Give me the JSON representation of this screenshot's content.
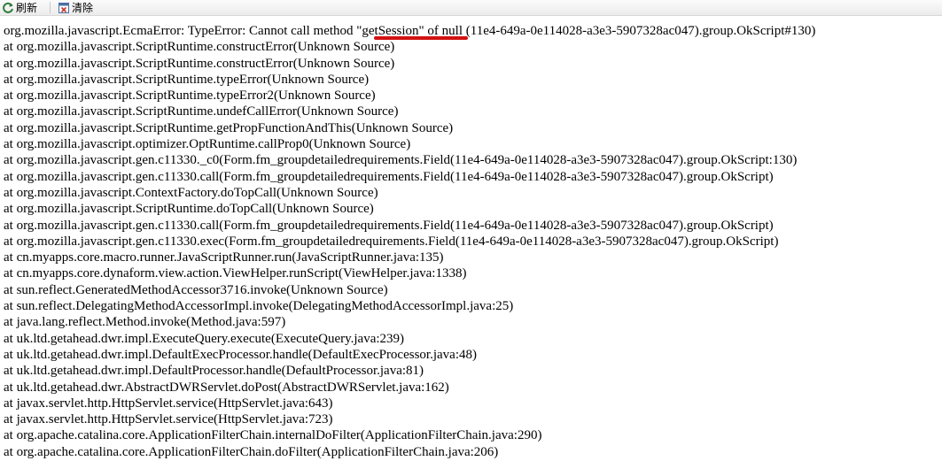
{
  "toolbar": {
    "refresh_label": "刷新",
    "clear_label": "清除",
    "refresh_icon": "refresh-icon",
    "clear_icon": "clear-icon"
  },
  "trace": {
    "lines": [
      "org.mozilla.javascript.EcmaError: TypeError: Cannot call method \"getSession\" of null (11e4-649a-0e114028-a3e3-5907328ac047).group.OkScript#130)",
      "at org.mozilla.javascript.ScriptRuntime.constructError(Unknown Source)",
      "at org.mozilla.javascript.ScriptRuntime.constructError(Unknown Source)",
      "at org.mozilla.javascript.ScriptRuntime.typeError(Unknown Source)",
      "at org.mozilla.javascript.ScriptRuntime.typeError2(Unknown Source)",
      "at org.mozilla.javascript.ScriptRuntime.undefCallError(Unknown Source)",
      "at org.mozilla.javascript.ScriptRuntime.getPropFunctionAndThis(Unknown Source)",
      "at org.mozilla.javascript.optimizer.OptRuntime.callProp0(Unknown Source)",
      "at org.mozilla.javascript.gen.c11330._c0(Form.fm_groupdetailedrequirements.Field(11e4-649a-0e114028-a3e3-5907328ac047).group.OkScript:130)",
      "at org.mozilla.javascript.gen.c11330.call(Form.fm_groupdetailedrequirements.Field(11e4-649a-0e114028-a3e3-5907328ac047).group.OkScript)",
      "at org.mozilla.javascript.ContextFactory.doTopCall(Unknown Source)",
      "at org.mozilla.javascript.ScriptRuntime.doTopCall(Unknown Source)",
      "at org.mozilla.javascript.gen.c11330.call(Form.fm_groupdetailedrequirements.Field(11e4-649a-0e114028-a3e3-5907328ac047).group.OkScript)",
      "at org.mozilla.javascript.gen.c11330.exec(Form.fm_groupdetailedrequirements.Field(11e4-649a-0e114028-a3e3-5907328ac047).group.OkScript)",
      "at cn.myapps.core.macro.runner.JavaScriptRunner.run(JavaScriptRunner.java:135)",
      "at cn.myapps.core.dynaform.view.action.ViewHelper.runScript(ViewHelper.java:1338)",
      "at sun.reflect.GeneratedMethodAccessor3716.invoke(Unknown Source)",
      "at sun.reflect.DelegatingMethodAccessorImpl.invoke(DelegatingMethodAccessorImpl.java:25)",
      "at java.lang.reflect.Method.invoke(Method.java:597)",
      "at uk.ltd.getahead.dwr.impl.ExecuteQuery.execute(ExecuteQuery.java:239)",
      "at uk.ltd.getahead.dwr.impl.DefaultExecProcessor.handle(DefaultExecProcessor.java:48)",
      "at uk.ltd.getahead.dwr.impl.DefaultProcessor.handle(DefaultProcessor.java:81)",
      "at uk.ltd.getahead.dwr.AbstractDWRServlet.doPost(AbstractDWRServlet.java:162)",
      "at javax.servlet.http.HttpServlet.service(HttpServlet.java:643)",
      "at javax.servlet.http.HttpServlet.service(HttpServlet.java:723)",
      "at org.apache.catalina.core.ApplicationFilterChain.internalDoFilter(ApplicationFilterChain.java:290)",
      "at org.apache.catalina.core.ApplicationFilterChain.doFilter(ApplicationFilterChain.java:206)"
    ]
  },
  "colors": {
    "annotation": "#d21212",
    "refresh_icon": "#2f7d3a",
    "clear_icon": "#c0392b"
  }
}
